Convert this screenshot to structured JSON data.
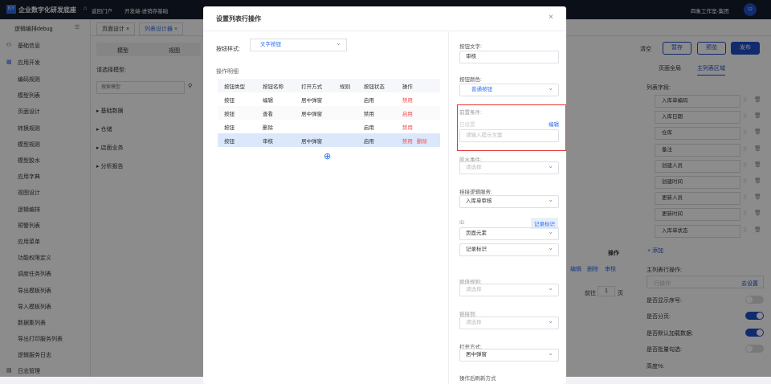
{
  "topbar": {
    "logo": "KY",
    "title": "企业数字化研发底座",
    "home": "返回门户",
    "project": "开发端-进销存基础",
    "org": "四象工作室-集团",
    "avatar": "12"
  },
  "sidebar": {
    "header": "逻辑编排debug",
    "groups": [
      {
        "label": "基础信息"
      },
      {
        "label": "应用开发"
      },
      {
        "label": "日志管理"
      }
    ],
    "items": [
      "编码规则",
      "模型列表",
      "页面设计",
      "转换规则",
      "模型规则",
      "模型胶水",
      "应用字典",
      "视图设计",
      "逻辑编排",
      "预警列表",
      "应用菜单",
      "功能权限定义",
      "调度任务列表",
      "导出模板列表",
      "导入模板列表",
      "数据集列表",
      "导出打印服务列表",
      "逻辑服务日志"
    ]
  },
  "tabs": [
    {
      "label": "页面设计"
    },
    {
      "label": "列表设计器"
    }
  ],
  "modelpanel": {
    "tab1": "模型",
    "tab2": "视图",
    "select_label": "请选择模型:",
    "search_placeholder": "搜索模型",
    "tree": [
      "基础数据",
      "仓储",
      "店面业务",
      "分析报告"
    ]
  },
  "toolbar": {
    "clear": "清空",
    "save": "暂存",
    "preview": "预览",
    "publish": "发布"
  },
  "canvas": {
    "op_header": "操作",
    "ops": [
      "编辑",
      "删除",
      "审核"
    ],
    "goto": "前往",
    "page": "1",
    "page_unit": "页"
  },
  "rightpanel": {
    "tab1": "页面全局",
    "tab2": "主列表区域",
    "fields_label": "列表字段:",
    "fields": [
      "入库单编码",
      "入库日期",
      "仓库",
      "备注",
      "创建人员",
      "创建时间",
      "更新人员",
      "更新时间",
      "入库单状态"
    ],
    "add": "+ 添加",
    "row_ops_label": "主列表行操作:",
    "row_ops_placeholder": "行操作",
    "row_ops_link": "去设置",
    "toggles": [
      {
        "label": "是否显示序号:",
        "on": false
      },
      {
        "label": "是否分页:",
        "on": true
      },
      {
        "label": "是否默认加载数据:",
        "on": true
      },
      {
        "label": "是否批量勾选:",
        "on": false
      }
    ],
    "height_label": "高度%:"
  },
  "modal": {
    "title": "设置列表行操作",
    "style_label": "按钮样式:",
    "style_value": "文字按钮",
    "detail_label": "操作明细",
    "columns": [
      "按钮类型",
      "按钮名称",
      "打开方式",
      "规则",
      "按钮状态",
      "操作"
    ],
    "rows": [
      [
        "按钮",
        "编辑",
        "居中弹窗",
        "",
        "启用",
        "禁用",
        ""
      ],
      [
        "按钮",
        "查看",
        "居中弹窗",
        "",
        "禁用",
        "启用",
        ""
      ],
      [
        "按钮",
        "删除",
        "",
        "",
        "启用",
        "禁用",
        ""
      ],
      [
        "按钮",
        "审核",
        "居中弹窗",
        "",
        "启用",
        "禁用",
        "删除"
      ]
    ],
    "form": {
      "text_label": "按钮文字:",
      "text_value": "审核",
      "color_label": "按钮颜色:",
      "color_value": "普通按钮",
      "pre_label": "前置条件:",
      "pre_status": "已设置",
      "pre_edit": "编辑",
      "pre_placeholder": "请输入提示文案",
      "glue_label": "胶水事件:",
      "glue_placeholder": "请选择",
      "logic_label": "挂接逻辑服务:",
      "logic_value": "入库单审核",
      "id_label": "ID",
      "id_tag": "记录标识",
      "id_sel1": "页面元素",
      "id_sel2": "记录标识",
      "assign_label": "赋值规则:",
      "assign_placeholder": "请选择",
      "link_label": "链接到:",
      "link_placeholder": "请选择",
      "open_label": "打开方式:",
      "open_value": "居中弹窗",
      "refresh_label": "操作后刷新方式"
    }
  }
}
